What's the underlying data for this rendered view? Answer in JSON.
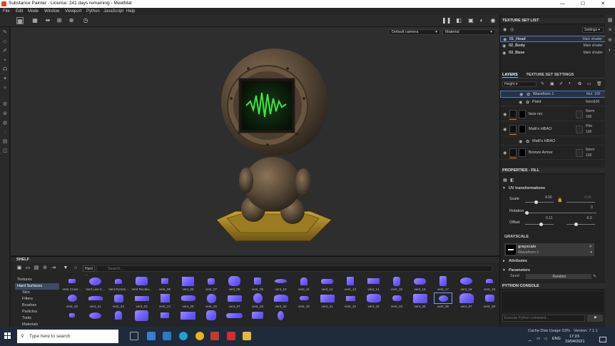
{
  "window": {
    "title": "Substance Painter - License: 241 days remaining - MeetMat",
    "controls": [
      "—",
      "☐",
      "✕"
    ]
  },
  "menu": [
    "File",
    "Edit",
    "Mode",
    "Window",
    "Viewport",
    "Python",
    "JavaScript",
    "Help"
  ],
  "viewport": {
    "camera": "Default camera",
    "mode": "Material"
  },
  "texture_set_list": {
    "title": "TEXTURE SET LIST",
    "settings_label": "Settings",
    "items": [
      {
        "name": "01_Head",
        "shader": "Main shader",
        "selected": true
      },
      {
        "name": "02_Body",
        "shader": "Main shader",
        "selected": false
      },
      {
        "name": "03_Base",
        "shader": "Main shader",
        "selected": false
      }
    ]
  },
  "layers": {
    "tabs": [
      "LAYERS",
      "TEXTURE SET SETTINGS"
    ],
    "channel": "Height",
    "items": [
      {
        "name": "Waveform 1",
        "blend": "Mul",
        "opacity": "100",
        "sub": true
      },
      {
        "name": "Paint",
        "blend": "Norm",
        "opacity": "100",
        "sub": true
      },
      {
        "name": "face rec",
        "blend": "Norm",
        "opacity": "100",
        "sub": false
      },
      {
        "name": "MatFx HBAO",
        "blend": "Pthr",
        "opacity": "100",
        "sub": false
      },
      {
        "name": "MatFx HBAO",
        "blend": "",
        "opacity": "",
        "sub": true
      },
      {
        "name": "Bronze Armor",
        "blend": "Norm",
        "opacity": "100",
        "sub": false
      }
    ]
  },
  "properties": {
    "title": "PROPERTIES - FILL",
    "uv_title": "UV transformations",
    "scale_label": "Scale",
    "scale_value": "4.06",
    "scale_value2": "4.06",
    "rotation_label": "Rotation",
    "rotation_value": "0",
    "offset_label": "Offset",
    "offset_x": "0.11",
    "offset_y": "-0.3",
    "grayscale_title": "GRAYSCALE",
    "grayscale_name": "grayscale",
    "grayscale_resource": "Waveform 1",
    "attributes_label": "Attributes",
    "parameters_label": "Parameters",
    "seed_label": "Seed",
    "seed_value": "Random"
  },
  "python_console": {
    "title": "PYTHON CONSOLE",
    "placeholder": "Execute Python command..."
  },
  "status": {
    "cache": "Cache Disk Usage:",
    "cache_value": "53%",
    "version": "Version: 7.1.1"
  },
  "shelf": {
    "title": "SHELF",
    "filter": "Hard ...",
    "search_placeholder": "Search...",
    "categories": [
      {
        "label": "Textures",
        "sel": false,
        "sub": false
      },
      {
        "label": "Hard Surfaces",
        "sel": true,
        "sub": false
      },
      {
        "label": "Skin",
        "sel": false,
        "sub": true
      },
      {
        "label": "Filters",
        "sel": false,
        "sub": true
      },
      {
        "label": "Brushes",
        "sel": false,
        "sub": true
      },
      {
        "label": "Particles",
        "sel": false,
        "sub": true
      },
      {
        "label": "Tools",
        "sel": false,
        "sub": true
      },
      {
        "label": "Materials",
        "sel": false,
        "sub": true
      },
      {
        "label": "Smart materials",
        "sel": false,
        "sub": true
      }
    ],
    "row1": [
      "Vent Cross ...",
      "Vent Line C...",
      "Vent Pyrami...",
      "Vent Rectan...",
      "vent_05",
      "vent_06",
      "vent_07",
      "vent_08",
      "vent_09",
      "vent_10",
      "vent_11",
      "vent_12",
      "vent_13",
      "vent_14",
      "vent_15",
      "vent_16",
      "vent_17",
      "vent_18",
      "vent_19"
    ],
    "row2": [
      "vent_20",
      "vent_21",
      "vent_22",
      "vent_23",
      "vent_24",
      "vent_25",
      "vent_26",
      "vent_27",
      "vent_28",
      "vent_29",
      "vent_30",
      "vent_31",
      "vent_32",
      "vent_33",
      "vent_34",
      "vent_35",
      "vent_36",
      "vent_37",
      "vent_38"
    ]
  },
  "taskbar": {
    "search_placeholder": "Type here to search",
    "lang": "ENG",
    "time": "17:23",
    "date": "19/04/2021"
  }
}
